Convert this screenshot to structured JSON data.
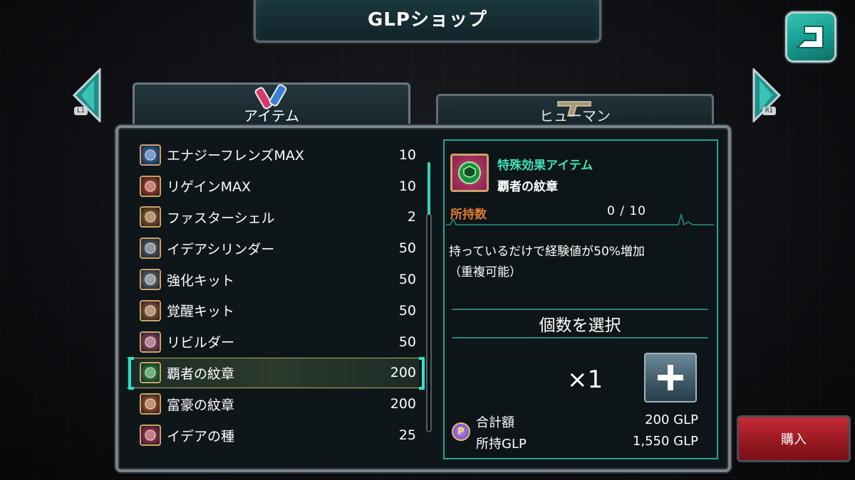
{
  "header": {
    "title": "GLPショップ"
  },
  "back_button": {
    "icon": "back-icon"
  },
  "nav": {
    "left_tag": "L1",
    "right_tag": "R1"
  },
  "tabs": [
    {
      "label": "アイテム",
      "icon": "potion-icon",
      "active": true
    },
    {
      "label": "ヒューマン",
      "icon": "gun-icon",
      "active": false
    }
  ],
  "items": [
    {
      "name": "エナジーフレンズMAX",
      "price": "10",
      "icon": "energy-potion-icon",
      "icon_color": "#3b78c9"
    },
    {
      "name": "リゲインMAX",
      "price": "10",
      "icon": "regain-potion-icon",
      "icon_color": "#c9452f"
    },
    {
      "name": "ファスターシェル",
      "price": "2",
      "icon": "shell-icon",
      "icon_color": "#a8682a"
    },
    {
      "name": "イデアシリンダー",
      "price": "50",
      "icon": "cylinder-icon",
      "icon_color": "#5d6a7a"
    },
    {
      "name": "強化キット",
      "price": "50",
      "icon": "kit-icon",
      "icon_color": "#6c7f86"
    },
    {
      "name": "覚醒キット",
      "price": "50",
      "icon": "awaken-kit-icon",
      "icon_color": "#b06a3c"
    },
    {
      "name": "リビルダー",
      "price": "50",
      "icon": "rebuilder-icon",
      "icon_color": "#b04f6f"
    },
    {
      "name": "覇者の紋章",
      "price": "200",
      "icon": "champion-emblem-icon",
      "icon_color": "#2c9a3f",
      "selected": true
    },
    {
      "name": "富豪の紋章",
      "price": "200",
      "icon": "wealth-emblem-icon",
      "icon_color": "#c0612a"
    },
    {
      "name": "イデアの種",
      "price": "25",
      "icon": "seed-icon",
      "icon_color": "#c0395a"
    }
  ],
  "detail": {
    "category": "特殊効果アイテム",
    "name": "覇者の紋章",
    "owned_label": "所持数",
    "owned_value": "0 / 10",
    "description_line1": "持っているだけで経験値が50%増加",
    "description_line2": "（重複可能）",
    "select_label": "個数を選択",
    "quantity": "×1",
    "total_label": "合計額",
    "total_value": "200 GLP",
    "owned_glp_label": "所持GLP",
    "owned_glp_value": "1,550 GLP",
    "coin_glyph": "P"
  },
  "buy_button": {
    "label": "購入"
  },
  "colors": {
    "accent": "#2ee3d0",
    "category_text": "#3ee0b6",
    "owned_label": "#e07a2e",
    "buy": "#c72a34"
  }
}
